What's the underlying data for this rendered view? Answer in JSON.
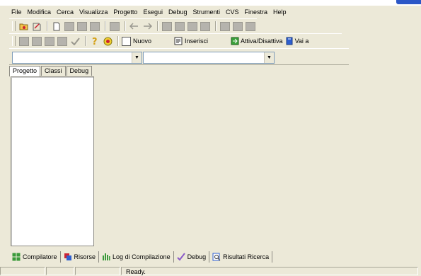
{
  "menu": [
    "File",
    "Modifica",
    "Cerca",
    "Visualizza",
    "Progetto",
    "Esegui",
    "Debug",
    "Strumenti",
    "CVS",
    "Finestra",
    "Help"
  ],
  "toolbar2": {
    "nuovo": "Nuovo",
    "inserisci": "Inserisci",
    "attiva": "Attiva/Disattiva",
    "vai_a": "Vai a"
  },
  "left_tabs": [
    "Progetto",
    "Classi",
    "Debug"
  ],
  "bottom_tabs": [
    "Compilatore",
    "Risorse",
    "Log di Compilazione",
    "Debug",
    "Risultati Ricerca"
  ],
  "status": {
    "ready": "Ready."
  },
  "colors": {
    "accent": "#2b57c7",
    "window_bg": "#ece9d8"
  }
}
